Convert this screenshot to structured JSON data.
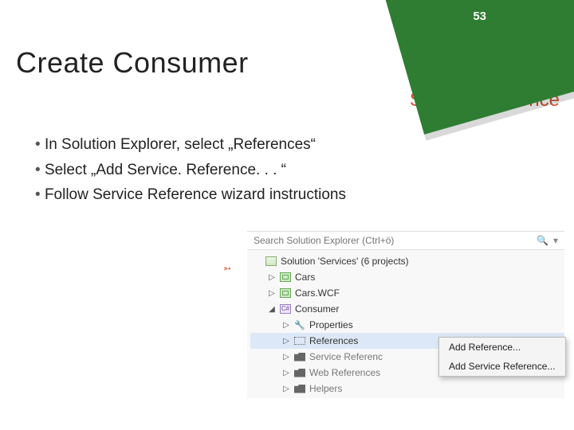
{
  "page_number": "53",
  "title": "Create Consumer",
  "subtitle": "Service reference",
  "bullets": [
    "In Solution Explorer, select „References“",
    "Select „Add Service. Reference. . . “",
    "Follow Service Reference wizard instructions"
  ],
  "explorer": {
    "search_placeholder": "Search Solution Explorer (Ctrl+ö)",
    "solution_label": "Solution 'Services' (6 projects)",
    "projects": [
      "Cars",
      "Cars.WCF",
      "Consumer"
    ],
    "consumer_children": [
      "Properties",
      "References",
      "Service Referenc",
      "Web References",
      "Helpers"
    ]
  },
  "context_menu": [
    "Add Reference...",
    "Add Service Reference..."
  ]
}
